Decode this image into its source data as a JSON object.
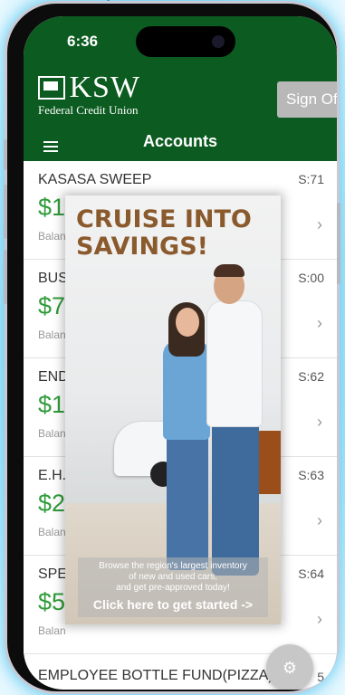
{
  "status_bar": {
    "time": "6:36"
  },
  "header": {
    "logo_text": "KSW",
    "logo_subtitle": "Federal Credit Union",
    "sign_button": "Sign Of",
    "title": "Accounts"
  },
  "accounts": [
    {
      "name": "KASASA SWEEP",
      "share": "S:71",
      "amount": "$1",
      "balance_label": "Balan"
    },
    {
      "name": "BUS",
      "share": "S:00",
      "amount": "$7",
      "balance_label": "Balan"
    },
    {
      "name": "END",
      "share": "S:62",
      "amount": "$1",
      "balance_label": "Balan"
    },
    {
      "name": "E.H.",
      "share": "S:63",
      "amount": "$2",
      "balance_label": "Balan"
    },
    {
      "name": "SPE",
      "share": "S:64",
      "amount": "$5",
      "balance_label": "Balan"
    }
  ],
  "last_account": {
    "name": "EMPLOYEE BOTTLE FUND(PIZZA)",
    "share": "5"
  },
  "ad": {
    "headline_line1": "CRUISE INTO",
    "headline_line2": "SAVINGS!",
    "body_line1": "Browse the region's largest inventory",
    "body_line2": "of new and used cars,",
    "body_line3": "and get pre-approved today!",
    "cta": "Click here to get started ->"
  },
  "icons": {
    "menu": "hamburger-icon",
    "chevron": "chevron-right-icon",
    "fab": "accessibility-icon"
  },
  "colors": {
    "brand_green": "#0c5b20",
    "amount_green": "#2f9b3a",
    "ad_headline": "#8a5a2d"
  }
}
